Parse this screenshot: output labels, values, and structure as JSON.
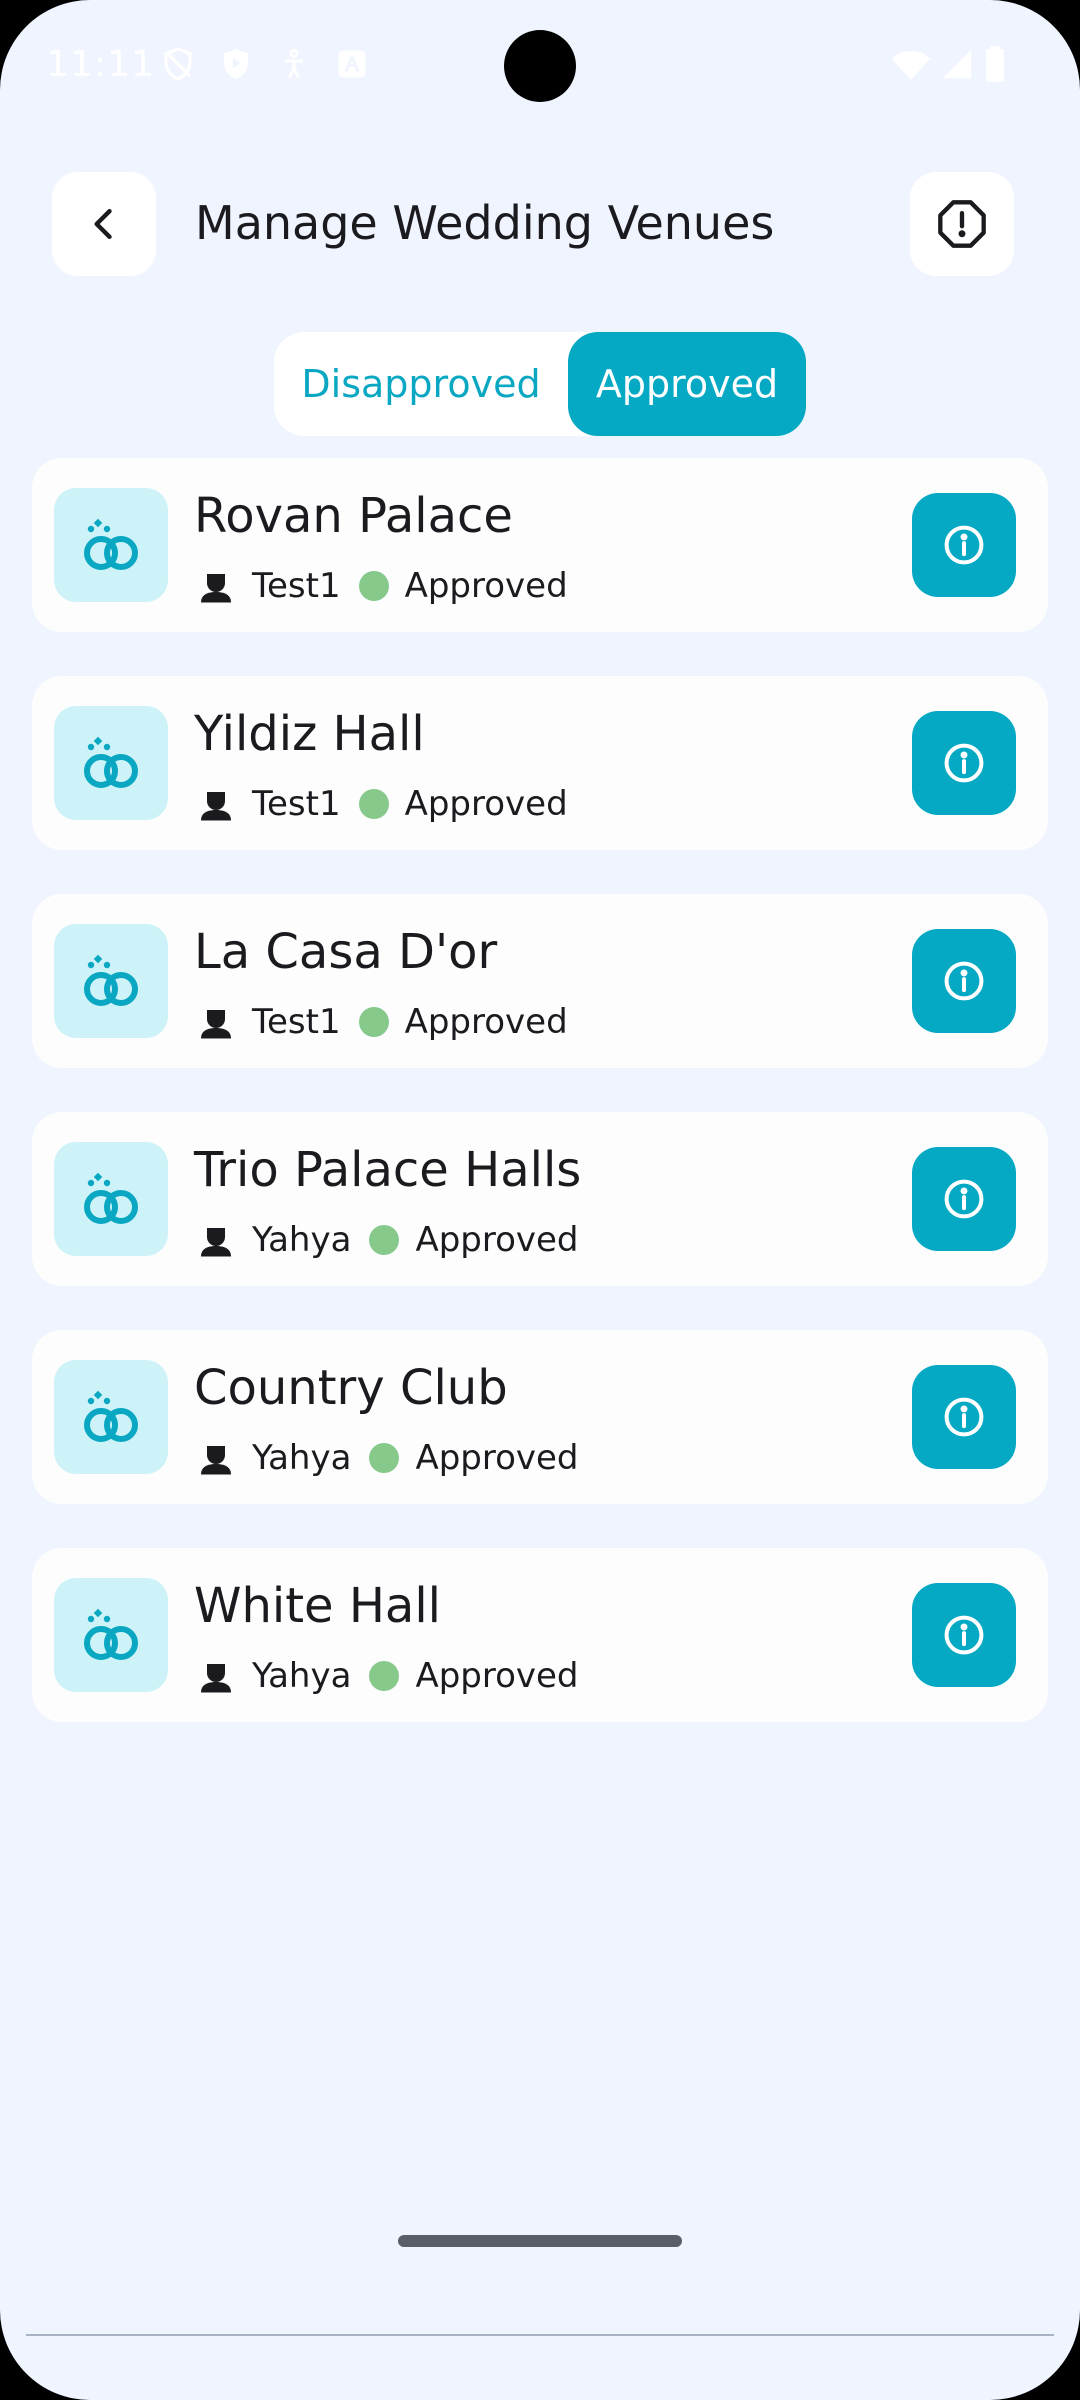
{
  "status_bar": {
    "time": "11:11"
  },
  "header": {
    "title": "Manage Wedding Venues"
  },
  "tabs": [
    {
      "label": "Disapproved",
      "selected": false
    },
    {
      "label": "Approved",
      "selected": true
    }
  ],
  "venues": [
    {
      "name": "Rovan Palace",
      "owner": "Test1",
      "status": "Approved"
    },
    {
      "name": "Yildiz Hall",
      "owner": "Test1",
      "status": "Approved"
    },
    {
      "name": "La Casa D'or",
      "owner": "Test1",
      "status": "Approved"
    },
    {
      "name": "Trio Palace Halls",
      "owner": "Yahya",
      "status": "Approved"
    },
    {
      "name": "Country Club",
      "owner": "Yahya",
      "status": "Approved"
    },
    {
      "name": "White Hall",
      "owner": "Yahya",
      "status": "Approved"
    }
  ],
  "colors": {
    "accent": "#06a9c4",
    "background": "#eff4fe",
    "thumb_bg": "#cdf3f8",
    "status_approved": "#86c98a"
  },
  "icons": {
    "back": "chevron-left-icon",
    "report": "alert-octagon-icon",
    "venue": "wedding-rings-icon",
    "owner": "person-icon",
    "info": "info-circle-icon"
  }
}
